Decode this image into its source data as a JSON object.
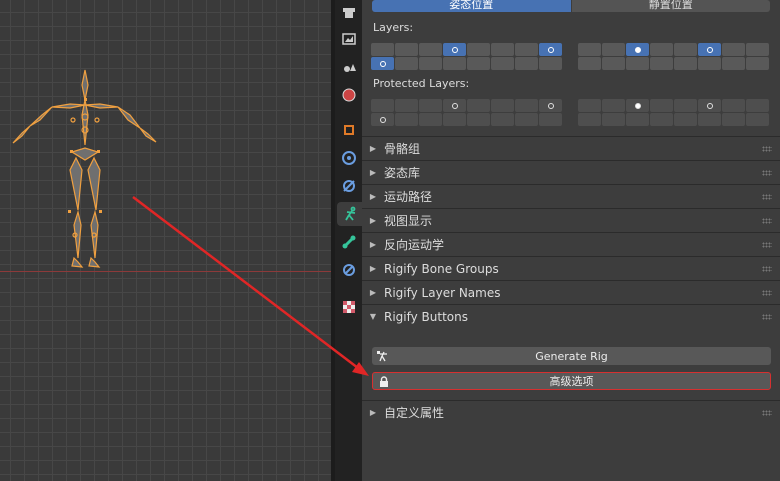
{
  "colors": {
    "accent_blue": "#4772b3",
    "panel_bg": "#3d3d3d",
    "annotation_red": "#e02626",
    "bone_orange": "#f0a040"
  },
  "armature": {
    "pose_toggle": {
      "pose_label": "姿态位置",
      "rest_label": "静置位置",
      "selected": "pose"
    },
    "layers_label": "Layers:",
    "protected_layers_label": "Protected Layers:"
  },
  "tabs": [
    {
      "name": "tool-tab",
      "icon": "tool-icon"
    },
    {
      "name": "render-tab",
      "icon": "image-icon"
    },
    {
      "name": "scene-tab",
      "icon": "scene-icon"
    },
    {
      "name": "world-tab",
      "icon": "world-icon"
    },
    {
      "name": "object-tab",
      "icon": "object-icon"
    },
    {
      "name": "physics-tab",
      "icon": "physics-icon"
    },
    {
      "name": "constraints-tab",
      "icon": "constraint-icon"
    },
    {
      "name": "armature-data-tab",
      "icon": "armature-icon",
      "active": true
    },
    {
      "name": "bone-tab",
      "icon": "bone-icon"
    },
    {
      "name": "bone-constraints-tab",
      "icon": "bone-constraint-icon"
    },
    {
      "name": "texture-tab",
      "icon": "texture-icon"
    }
  ],
  "sections": [
    {
      "label": "骨骼组",
      "expanded": false
    },
    {
      "label": "姿态库",
      "expanded": false
    },
    {
      "label": "运动路径",
      "expanded": false
    },
    {
      "label": "视图显示",
      "expanded": false
    },
    {
      "label": "反向运动学",
      "expanded": false
    },
    {
      "label": "Rigify Bone Groups",
      "expanded": false
    },
    {
      "label": "Rigify Layer Names",
      "expanded": false
    },
    {
      "label": "Rigify Buttons",
      "expanded": true
    }
  ],
  "rigify_buttons": {
    "generate_label": "Generate Rig",
    "advanced_label": "高级选项"
  },
  "custom_props_label": "自定义属性",
  "icons": {
    "expanded": "▼",
    "collapsed": "▶"
  }
}
